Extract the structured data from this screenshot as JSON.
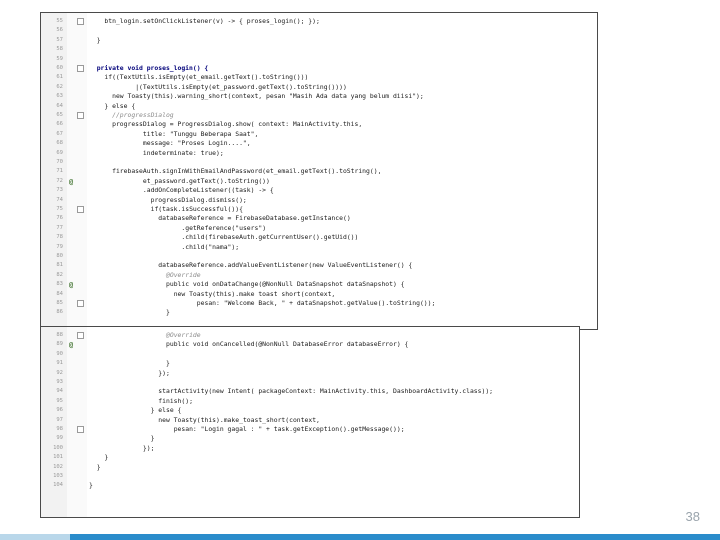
{
  "page_number": "38",
  "colors": {
    "footer_light": "#b9d7ea",
    "footer_dark": "#2a8ccb"
  },
  "top_panel": {
    "lines": [
      {
        "ln": "55",
        "indent": 4,
        "code": "btn_login.setOnClickListener(v) -> { proses_login(); });"
      },
      {
        "ln": "56",
        "indent": 0,
        "code": ""
      },
      {
        "ln": "57",
        "indent": 2,
        "code": "}"
      },
      {
        "ln": "58",
        "indent": 0,
        "code": ""
      },
      {
        "ln": "59",
        "indent": 0,
        "code": ""
      },
      {
        "ln": "60",
        "indent": 2,
        "code": "private void proses_login() {",
        "kw": true
      },
      {
        "ln": "61",
        "indent": 4,
        "code": "if((TextUtils.isEmpty(et_email.getText().toString()))"
      },
      {
        "ln": "62",
        "indent": 12,
        "code": "|(TextUtils.isEmpty(et_password.getText().toString())))"
      },
      {
        "ln": "63",
        "indent": 6,
        "code": "new Toasty(this).warning_short(context, pesan \"Masih Ada data yang belum diisi\");"
      },
      {
        "ln": "64",
        "indent": 4,
        "code": "} else {"
      },
      {
        "ln": "65",
        "indent": 6,
        "code": "//progressDialog",
        "cm": true
      },
      {
        "ln": "66",
        "indent": 6,
        "code": "progressDialog = ProgressDialog.show( context: MainActivity.this,"
      },
      {
        "ln": "67",
        "indent": 14,
        "code": "title: \"Tunggu Beberapa Saat\","
      },
      {
        "ln": "68",
        "indent": 14,
        "code": "message: \"Proses Login....\","
      },
      {
        "ln": "69",
        "indent": 14,
        "code": "indeterminate: true);"
      },
      {
        "ln": "70",
        "indent": 0,
        "code": ""
      },
      {
        "ln": "71",
        "indent": 6,
        "code": "firebaseAuth.signInWithEmailAndPassword(et_email.getText().toString(),"
      },
      {
        "ln": "72",
        "indent": 14,
        "code": "et_password.getText().toString())",
        "mk": "@"
      },
      {
        "ln": "73",
        "indent": 14,
        "code": ".addOnCompleteListener((task) -> {"
      },
      {
        "ln": "74",
        "indent": 16,
        "code": "progressDialog.dismiss();"
      },
      {
        "ln": "75",
        "indent": 16,
        "code": "if(task.isSuccessful()){"
      },
      {
        "ln": "76",
        "indent": 18,
        "code": "databaseReference = FirebaseDatabase.getInstance()"
      },
      {
        "ln": "77",
        "indent": 24,
        "code": ".getReference(\"users\")"
      },
      {
        "ln": "78",
        "indent": 24,
        "code": ".child(firebaseAuth.getCurrentUser().getUid())"
      },
      {
        "ln": "79",
        "indent": 24,
        "code": ".child(\"nama\");"
      },
      {
        "ln": "80",
        "indent": 0,
        "code": ""
      },
      {
        "ln": "81",
        "indent": 18,
        "code": "databaseReference.addValueEventListener(new ValueEventListener() {"
      },
      {
        "ln": "82",
        "indent": 20,
        "code": "@Override",
        "cm": true
      },
      {
        "ln": "83",
        "indent": 20,
        "code": "public void onDataChange(@NonNull DataSnapshot dataSnapshot) {",
        "mk": "@"
      },
      {
        "ln": "84",
        "indent": 22,
        "code": "new Toasty(this).make toast short(context,"
      },
      {
        "ln": "85",
        "indent": 28,
        "code": "pesan: \"Welcome Back, \" + dataSnapshot.getValue().toString());"
      },
      {
        "ln": "86",
        "indent": 20,
        "code": "}"
      }
    ]
  },
  "bottom_panel": {
    "lines": [
      {
        "ln": "88",
        "indent": 20,
        "code": "@Override",
        "cm": true
      },
      {
        "ln": "89",
        "indent": 20,
        "code": "public void onCancelled(@NonNull DatabaseError databaseError) {",
        "mk": "@"
      },
      {
        "ln": "90",
        "indent": 0,
        "code": ""
      },
      {
        "ln": "91",
        "indent": 20,
        "code": "}"
      },
      {
        "ln": "92",
        "indent": 18,
        "code": "});"
      },
      {
        "ln": "93",
        "indent": 0,
        "code": ""
      },
      {
        "ln": "94",
        "indent": 18,
        "code": "startActivity(new Intent( packageContext: MainActivity.this, DashboardActivity.class));"
      },
      {
        "ln": "95",
        "indent": 18,
        "code": "finish();"
      },
      {
        "ln": "96",
        "indent": 16,
        "code": "} else {"
      },
      {
        "ln": "97",
        "indent": 18,
        "code": "new Toasty(this).make_toast_short(context,"
      },
      {
        "ln": "98",
        "indent": 22,
        "code": "pesan: \"Login gagal : \" + task.getException().getMessage());"
      },
      {
        "ln": "99",
        "indent": 16,
        "code": "}"
      },
      {
        "ln": "100",
        "indent": 14,
        "code": "});"
      },
      {
        "ln": "101",
        "indent": 4,
        "code": "}"
      },
      {
        "ln": "102",
        "indent": 2,
        "code": "}"
      },
      {
        "ln": "103",
        "indent": 0,
        "code": ""
      },
      {
        "ln": "104",
        "indent": 0,
        "code": "}"
      }
    ]
  }
}
